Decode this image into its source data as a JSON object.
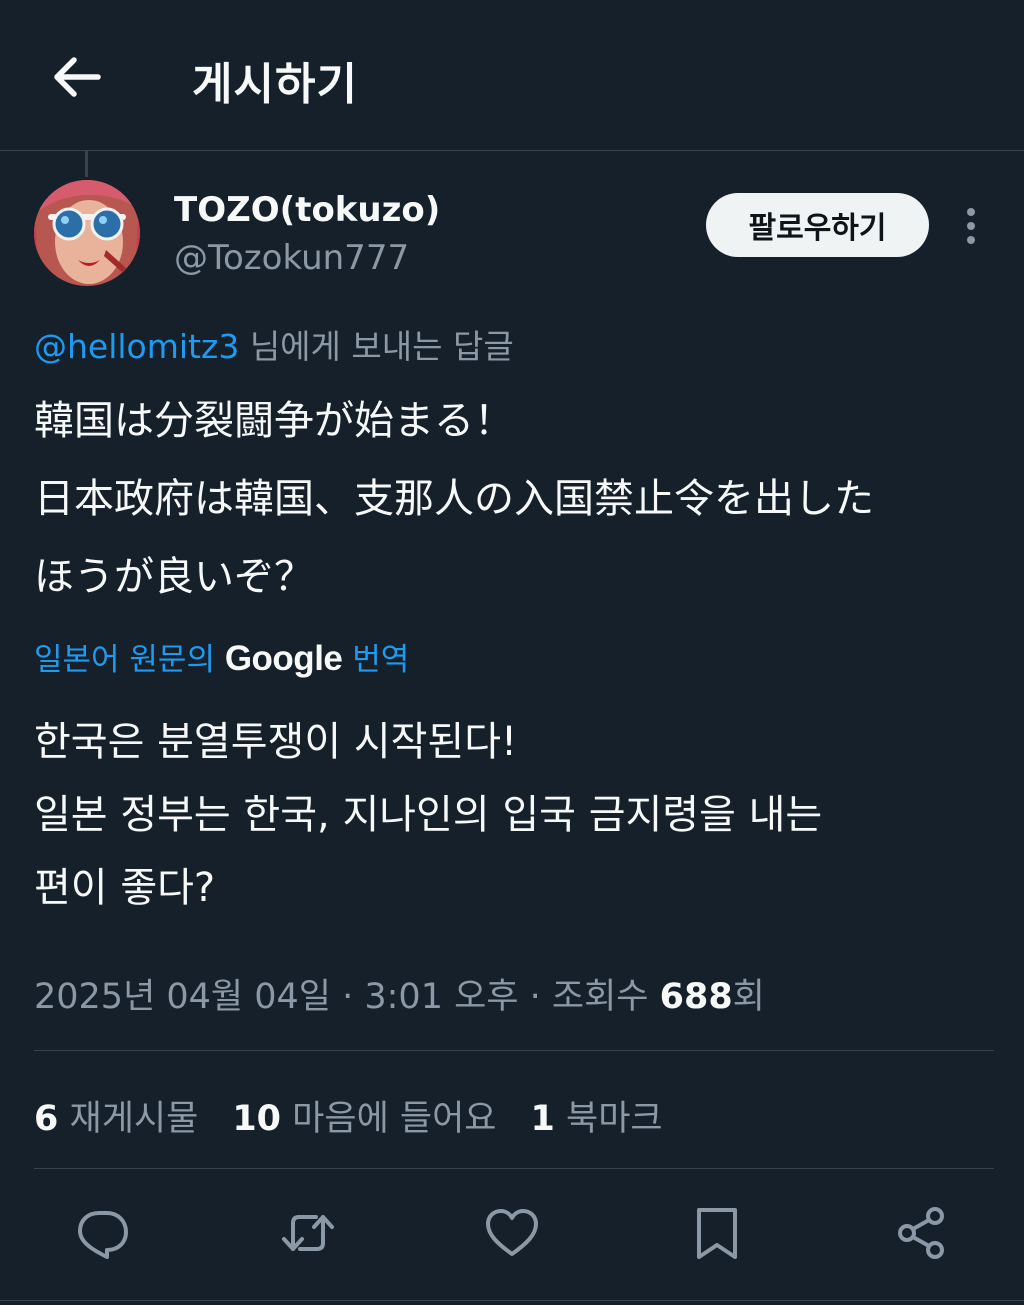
{
  "header": {
    "title": "게시하기",
    "back_icon": "arrow-left-icon"
  },
  "author": {
    "name": "TOZO(tokuzo)",
    "handle": "@Tozokun777",
    "follow_label": "팔로우하기"
  },
  "reply": {
    "mention": "@hellomitz3",
    "suffix": " 님에게 보내는 답글"
  },
  "post": {
    "original": "韓国は分裂闘争が始まる！\n日本政府は韓国、支那人の入国禁止令を出した\nほうが良いぞ？",
    "translation_prefix": "일본어 원문의 ",
    "translation_brand": "Google",
    "translation_suffix": " 번역",
    "translated": "한국은 분열투쟁이 시작된다!\n일본 정부는 한국, 지나인의 입국 금지령을 내는\n편이 좋다?"
  },
  "meta": {
    "datetime": "2025년 04월 04일 · 3:01 오후 · 조회수 ",
    "views": "688",
    "views_suffix": "회"
  },
  "stats": [
    {
      "count": "6",
      "label": "재게시물"
    },
    {
      "count": "10",
      "label": "마음에 들어요"
    },
    {
      "count": "1",
      "label": "북마크"
    }
  ],
  "actions": [
    "reply-icon",
    "repost-icon",
    "like-icon",
    "bookmark-icon",
    "share-icon"
  ],
  "colors": {
    "background": "#15202b",
    "accent": "#1d9bf0",
    "secondary_text": "#8b98a5",
    "divider": "#38444d"
  }
}
